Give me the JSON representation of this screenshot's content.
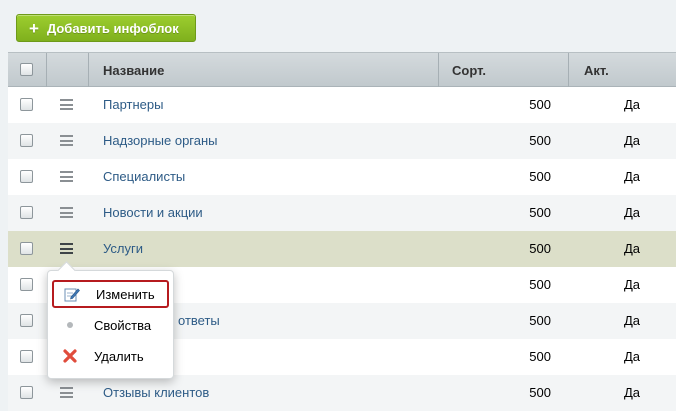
{
  "toolbar": {
    "add_label": "Добавить инфоблок",
    "add_icon": "plus-icon"
  },
  "columns": {
    "name": "Название",
    "sort": "Сорт.",
    "active": "Акт."
  },
  "rows": [
    {
      "name": "Партнеры",
      "sort": "500",
      "active": "Да"
    },
    {
      "name": "Надзорные органы",
      "sort": "500",
      "active": "Да"
    },
    {
      "name": "Специалисты",
      "sort": "500",
      "active": "Да"
    },
    {
      "name": "Новости и акции",
      "sort": "500",
      "active": "Да"
    },
    {
      "name": "Услуги",
      "sort": "500",
      "active": "Да"
    },
    {
      "name": "",
      "sort": "500",
      "active": "Да"
    },
    {
      "name": "ответы",
      "sort": "500",
      "active": "Да"
    },
    {
      "name": "",
      "sort": "500",
      "active": "Да"
    },
    {
      "name": "Отзывы клиентов",
      "sort": "500",
      "active": "Да"
    }
  ],
  "context_menu": {
    "items": [
      {
        "label": "Изменить",
        "icon": "edit-icon"
      },
      {
        "label": "Свойства",
        "icon": "dot-icon"
      },
      {
        "label": "Удалить",
        "icon": "delete-icon"
      }
    ]
  },
  "colors": {
    "accent_green": "#8dc024",
    "link": "#2d5b86",
    "highlight_row": "#dcdfc9",
    "menu_selection": "#b61b1f"
  }
}
